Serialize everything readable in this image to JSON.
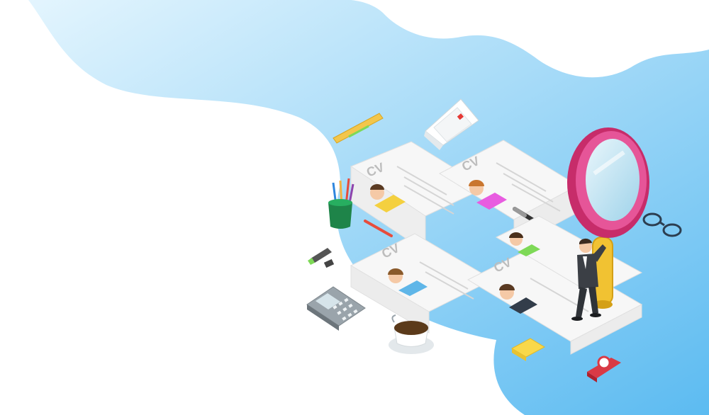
{
  "scene": {
    "cv_label": "CV",
    "colors": {
      "sky_light": "#dff3fd",
      "sky_dark": "#6ec3f3",
      "paper": "#f7f7f7",
      "magnifier_rim": "#d63a78",
      "handle": "#f1c232",
      "cup": "#5b3a1a",
      "stapler": "#d93a45"
    },
    "resumes": [
      {
        "shirt": "#f4d03f",
        "hair": "#5a3a22"
      },
      {
        "shirt": "#e85ce0",
        "hair": "#c9762f"
      },
      {
        "shirt": "#5fb6e8",
        "hair": "#8a5a2b"
      },
      {
        "shirt": "#333d4a",
        "hair": "#5a3a22"
      },
      {
        "shirt": "#7ed957",
        "hair": "#4a2f1a"
      }
    ]
  }
}
